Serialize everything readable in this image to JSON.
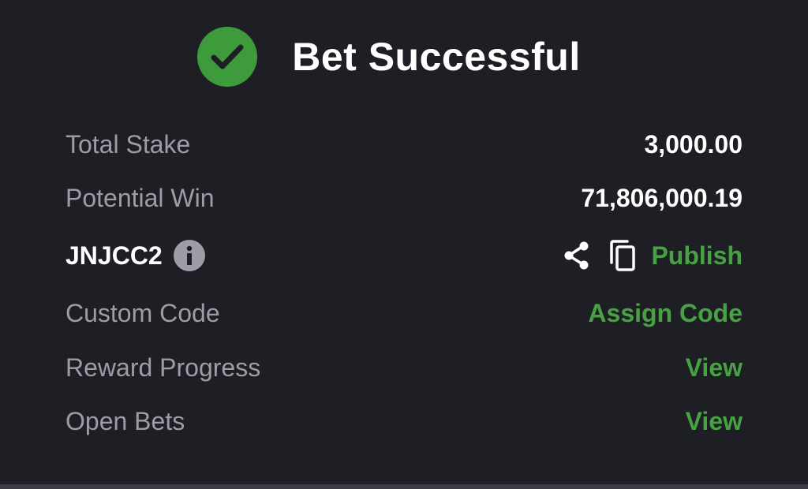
{
  "header": {
    "title": "Bet Successful",
    "icon": "check-circle-icon"
  },
  "summary": {
    "total_stake_label": "Total Stake",
    "total_stake_value": "3,000.00",
    "potential_win_label": "Potential Win",
    "potential_win_value": "71,806,000.19"
  },
  "booking": {
    "code": "JNJCC2",
    "publish_label": "Publish"
  },
  "custom_code": {
    "label": "Custom Code",
    "action_label": "Assign Code"
  },
  "reward_progress": {
    "label": "Reward Progress",
    "action_label": "View"
  },
  "open_bets": {
    "label": "Open Bets",
    "action_label": "View"
  },
  "colors": {
    "background": "#1e1f24",
    "accent_green": "#48a244",
    "success_badge": "#3e9b3c",
    "muted_text": "#9c9da6",
    "primary_text": "#ffffff"
  }
}
